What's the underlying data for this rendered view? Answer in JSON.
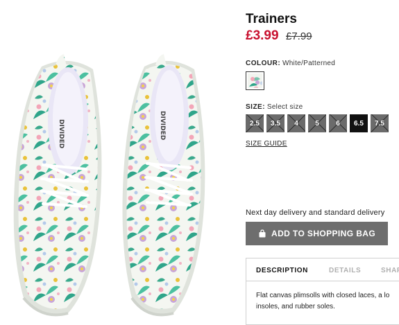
{
  "product": {
    "title": "Trainers",
    "price": "£3.99",
    "old_price": "£7.99"
  },
  "shoe_brand_text": "DIVIDED",
  "colour": {
    "label": "COLOUR:",
    "value": "White/Patterned"
  },
  "size": {
    "label": "SIZE:",
    "value": "Select size",
    "options": [
      {
        "label": "2.5",
        "available": false
      },
      {
        "label": "3.5",
        "available": false
      },
      {
        "label": "4",
        "available": false
      },
      {
        "label": "5",
        "available": false
      },
      {
        "label": "6",
        "available": false
      },
      {
        "label": "6.5",
        "available": true,
        "selected": true
      },
      {
        "label": "7.5",
        "available": false
      }
    ],
    "guide_label": "SIZE GUIDE"
  },
  "delivery_text": "Next day delivery and standard delivery",
  "add_button": {
    "label": "ADD TO SHOPPING BAG",
    "icon": "shopping-bag-icon"
  },
  "tabs": [
    {
      "label": "DESCRIPTION",
      "active": true
    },
    {
      "label": "DETAILS",
      "active": false
    },
    {
      "label": "SHAR",
      "active": false
    }
  ],
  "description_lines": [
    "Flat canvas plimsolls with closed laces, a lo",
    "insoles, and rubber soles."
  ],
  "colors": {
    "price_red": "#c8102e",
    "button_grey": "#6e6e6e",
    "selected_size": "#111111",
    "unavailable_size": "#6b6b6b"
  }
}
